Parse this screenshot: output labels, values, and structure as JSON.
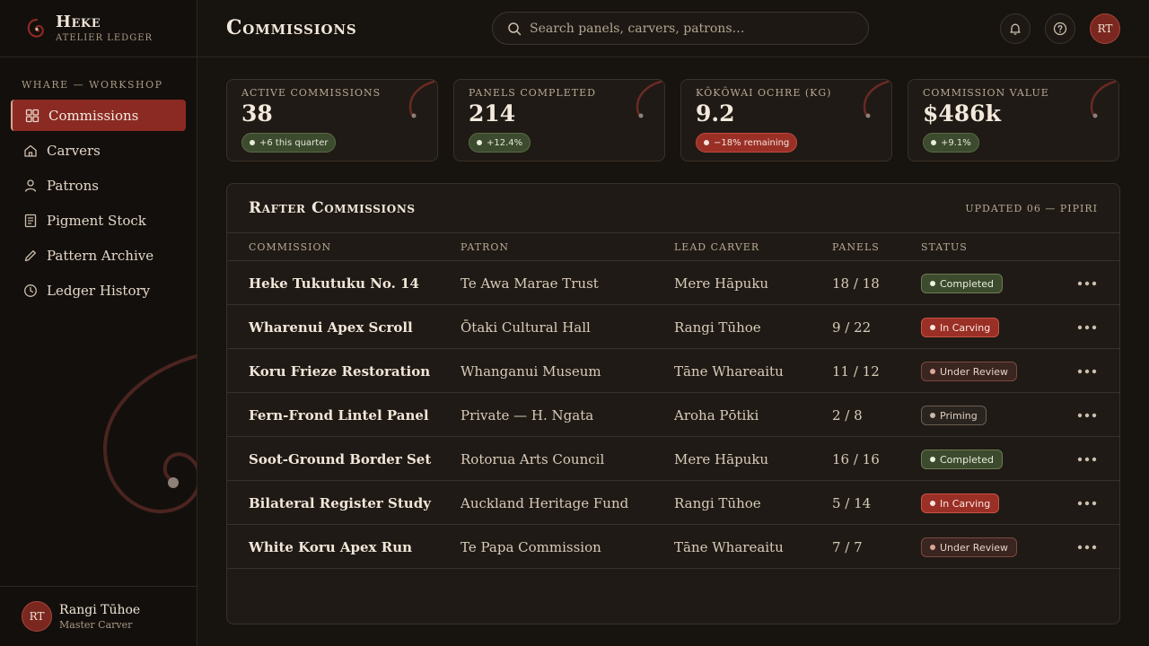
{
  "brand": {
    "name": "Heke",
    "subtitle": "Atelier Ledger"
  },
  "sidebar": {
    "section_label": "Whare — Workshop",
    "items": [
      {
        "label": "Commissions",
        "icon": "grid-icon",
        "active": true
      },
      {
        "label": "Carvers",
        "icon": "home-icon",
        "active": false
      },
      {
        "label": "Patrons",
        "icon": "user-icon",
        "active": false
      },
      {
        "label": "Pigment Stock",
        "icon": "document-icon",
        "active": false
      },
      {
        "label": "Pattern Archive",
        "icon": "pencil-icon",
        "active": false
      },
      {
        "label": "Ledger History",
        "icon": "clock-icon",
        "active": false
      }
    ]
  },
  "user": {
    "initials": "RT",
    "name": "Rangi Tūhoe",
    "role": "Master Carver"
  },
  "header": {
    "title": "Commissions",
    "search_placeholder": "Search panels, carvers, patrons…",
    "notification_icon": "bell-icon",
    "help_icon": "help-icon",
    "avatar_initials": "RT"
  },
  "stats": [
    {
      "label": "Active Commissions",
      "value": "38",
      "delta": "+6 this quarter",
      "trend": "positive"
    },
    {
      "label": "Panels Completed",
      "value": "214",
      "delta": "+12.4%",
      "trend": "positive"
    },
    {
      "label": "Kōkōwai Ochre (kg)",
      "value": "9.2",
      "delta": "−18% remaining",
      "trend": "negative"
    },
    {
      "label": "Commission Value",
      "value": "$486k",
      "delta": "+9.1%",
      "trend": "positive"
    }
  ],
  "table": {
    "title": "Rafter Commissions",
    "updated": "Updated 06 — Pipiri",
    "columns": [
      "Commission",
      "Patron",
      "Lead Carver",
      "Panels",
      "Status"
    ],
    "rows": [
      {
        "commission": "Heke Tukutuku No. 14",
        "patron": "Te Awa Marae Trust",
        "carver": "Mere Hāpuku",
        "panels": "18 / 18",
        "status": "Completed",
        "status_type": "completed"
      },
      {
        "commission": "Wharenui Apex Scroll",
        "patron": "Ōtaki Cultural Hall",
        "carver": "Rangi Tūhoe",
        "panels": "9 / 22",
        "status": "In Carving",
        "status_type": "carving"
      },
      {
        "commission": "Koru Frieze Restoration",
        "patron": "Whanganui Museum",
        "carver": "Tāne Whareaitu",
        "panels": "11 / 12",
        "status": "Under Review",
        "status_type": "review"
      },
      {
        "commission": "Fern-Frond Lintel Panel",
        "patron": "Private — H. Ngata",
        "carver": "Aroha Pōtiki",
        "panels": "2 / 8",
        "status": "Priming",
        "status_type": "priming"
      },
      {
        "commission": "Soot-Ground Border Set",
        "patron": "Rotorua Arts Council",
        "carver": "Mere Hāpuku",
        "panels": "16 / 16",
        "status": "Completed",
        "status_type": "completed"
      },
      {
        "commission": "Bilateral Register Study",
        "patron": "Auckland Heritage Fund",
        "carver": "Rangi Tūhoe",
        "panels": "5 / 14",
        "status": "In Carving",
        "status_type": "carving"
      },
      {
        "commission": "White Koru Apex Run",
        "patron": "Te Papa Commission",
        "carver": "Tāne Whareaitu",
        "panels": "7 / 7",
        "status": "Under Review",
        "status_type": "review"
      }
    ],
    "row_action_icon": "more-icon"
  },
  "colors": {
    "accent": "#8a2a23",
    "positive": "#3c4a2e",
    "background": "#17130f"
  }
}
